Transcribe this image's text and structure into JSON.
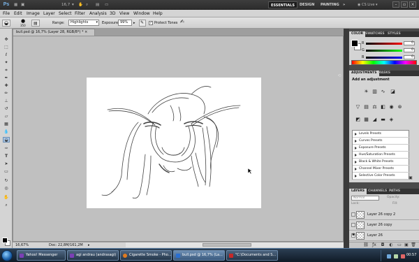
{
  "appbar": {
    "logo": "Ps",
    "zoom": "16,7",
    "workspaces": [
      "ESSENTIALS",
      "DESIGN",
      "PAINTING"
    ],
    "more": "»",
    "cslive": "CS Live"
  },
  "menu": [
    "File",
    "Edit",
    "Image",
    "Layer",
    "Select",
    "Filter",
    "Analysis",
    "3D",
    "View",
    "Window",
    "Help"
  ],
  "options": {
    "brush_size": "350",
    "range_label": "Range:",
    "range_value": "Highlights",
    "exposure_label": "Exposure:",
    "exposure_value": "99%",
    "protect_tones": "Protect Tones",
    "protect_tones_checked": true
  },
  "document": {
    "tab_title": "bull.psd @ 16,7% (Layer 28, RGB/8*) *",
    "close": "×",
    "status_zoom": "16,67%",
    "status_doc": "Doc: 22,8M/161,2M"
  },
  "color_panel": {
    "tabs": [
      "COLOR",
      "SWATCHES",
      "STYLES"
    ],
    "channels": [
      {
        "label": "R",
        "value": "0",
        "gradient": "#ff0000"
      },
      {
        "label": "G",
        "value": "0",
        "gradient": "#00ff00"
      },
      {
        "label": "B",
        "value": "0",
        "gradient": "#0000ff"
      }
    ]
  },
  "adjustments_panel": {
    "tabs": [
      "ADJUSTMENTS",
      "MASKS"
    ],
    "title": "Add an adjustment",
    "presets": [
      "Levels Presets",
      "Curves Presets",
      "Exposure Presets",
      "Hue/Saturation Presets",
      "Black & White Presets",
      "Channel Mixer Presets",
      "Selective Color Presets"
    ]
  },
  "layers_panel": {
    "tabs": [
      "LAYERS",
      "CHANNELS",
      "PATHS"
    ],
    "blend_mode": "Normal",
    "opacity_label": "Opacity:",
    "lock_label": "Lock:",
    "fill_label": "Fill:",
    "layers": [
      "Layer 26 copy 2",
      "Layer 26 copy",
      "Layer 26"
    ]
  },
  "taskbar": {
    "tasks": [
      {
        "label": "Yahoo! Messenger",
        "color": "#7b3fb5"
      },
      {
        "label": "agi andrau (andrasagi)",
        "color": "#7b3fb5"
      },
      {
        "label": "Cigarette Smoke - Pho...",
        "color": "#e07a1f"
      },
      {
        "label": "bull.psd @ 16,7% (La...",
        "color": "#2a6fd1"
      },
      {
        "label": "\"C:\\Documents and S...",
        "color": "#c62828"
      }
    ],
    "clock": "00:57"
  },
  "colors": {
    "accent_active_tool": "#a9c6e6",
    "panel_bg": "#d4d4d4",
    "canvas_bg": "#c0c0c0",
    "app_dark": "#2d2d2d"
  }
}
